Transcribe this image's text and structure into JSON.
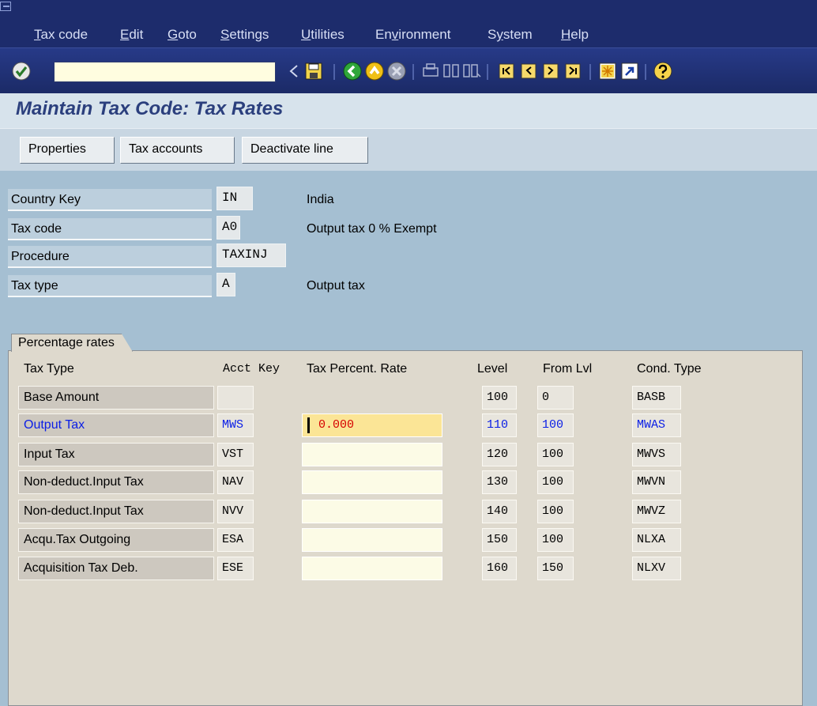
{
  "menu": [
    "Tax code",
    "Edit",
    "Goto",
    "Settings",
    "Utilities",
    "Environment",
    "System",
    "Help"
  ],
  "menu_mnemonics": [
    "T",
    "E",
    "G",
    "S",
    "U",
    "v",
    "y",
    "H"
  ],
  "title": "Maintain Tax Code: Tax Rates",
  "app_buttons": [
    "Properties",
    "Tax accounts",
    "Deactivate line"
  ],
  "header": {
    "country_key": {
      "label": "Country Key",
      "value": "IN",
      "desc": "India"
    },
    "tax_code": {
      "label": "Tax code",
      "value": "A0",
      "desc": "Output tax 0 % Exempt"
    },
    "procedure": {
      "label": "Procedure",
      "value": "TAXINJ",
      "desc": ""
    },
    "tax_type": {
      "label": "Tax type",
      "value": "A",
      "desc": "Output tax"
    }
  },
  "group": {
    "title": "Percentage rates",
    "columns": [
      "Tax Type",
      "Acct Key",
      "Tax Percent. Rate",
      "Level",
      "From Lvl",
      "Cond. Type"
    ],
    "rows": [
      {
        "tax_type": "Base Amount",
        "acct_key": "",
        "rate": "",
        "level": "100",
        "from_lvl": "0",
        "cond_type": "BASB"
      },
      {
        "tax_type": "Output Tax",
        "acct_key": "MWS",
        "rate": "0.000",
        "level": "110",
        "from_lvl": "100",
        "cond_type": "MWAS"
      },
      {
        "tax_type": "Input Tax",
        "acct_key": "VST",
        "rate": "",
        "level": "120",
        "from_lvl": "100",
        "cond_type": "MWVS"
      },
      {
        "tax_type": "Non-deduct.Input Tax",
        "acct_key": "NAV",
        "rate": "",
        "level": "130",
        "from_lvl": "100",
        "cond_type": "MWVN"
      },
      {
        "tax_type": "Non-deduct.Input Tax",
        "acct_key": "NVV",
        "rate": "",
        "level": "140",
        "from_lvl": "100",
        "cond_type": "MWVZ"
      },
      {
        "tax_type": "Acqu.Tax Outgoing",
        "acct_key": "ESA",
        "rate": "",
        "level": "150",
        "from_lvl": "100",
        "cond_type": "NLXA"
      },
      {
        "tax_type": "Acquisition Tax Deb.",
        "acct_key": "ESE",
        "rate": "",
        "level": "160",
        "from_lvl": "150",
        "cond_type": "NLXV"
      }
    ]
  },
  "colors": {
    "menubar": "#1d2c6c",
    "background": "#a5bfd2",
    "active_row": "#0a1ee6",
    "active_input": "#fbe596",
    "rate_text": "#d60000",
    "title": "#2b3f7d"
  },
  "icons": [
    "enter-icon",
    "command-field-icon",
    "back-arrow-icon",
    "save-icon",
    "back-icon",
    "exit-icon",
    "cancel-icon",
    "print-icon",
    "find-icon",
    "find-next-icon",
    "first-page-icon",
    "previous-page-icon",
    "next-page-icon",
    "last-page-icon",
    "create-session-icon",
    "shortcut-icon",
    "help-icon"
  ]
}
